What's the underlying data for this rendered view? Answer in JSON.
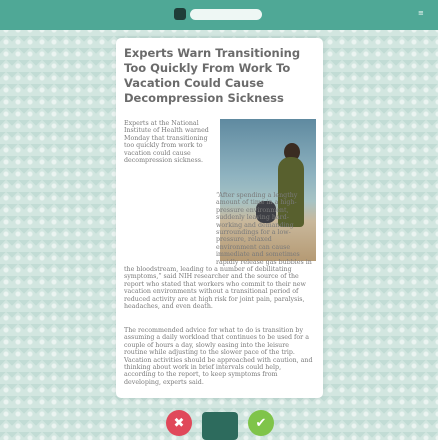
{
  "header": {
    "search_placeholder": "",
    "menu_label": "≡"
  },
  "article": {
    "headline": "Experts Warn Transitioning Too Quickly From Work To Vacation Could Cause Decompression Sickness",
    "paragraphs": [
      "Experts at the National Institute of Health warned Monday that transitioning too quickly from work to vacation could cause decompression sickness.",
      "“After spending a lengthy amount of time in a high-pressure environment, suddenly leaving hard-working and demanding surroundings for a low-pressure, relaxed environment can cause immediate and sometimes rapidly release gas bubbles in the bloodstream, leading to a number of debilitating symptoms,” said NIH researcher and the source of the report who stated that workers who commit to their new vacation environments without a transitional period of reduced activity are at high risk for joint pain, paralysis, headaches, and even death.",
      "The recommended advice for what to do is transition by assuming a daily workload that continues to be used for a couple of hours a day, slowly easing into the leisure routine while adjusting to the slower pace of the trip. Vacation activities should be approached with caution, and thinking about work in brief intervals could help, according to the report, to keep symptoms from developing, experts said."
    ],
    "photo_alt": "Person sitting on a beach with a dog"
  },
  "actions": {
    "reject_icon": "✖",
    "share_label": "",
    "accept_icon": "✔"
  },
  "colors": {
    "topbar": "#4fa896",
    "reject": "#e0485a",
    "share": "#2d6b5d",
    "accept": "#7fc44a"
  }
}
